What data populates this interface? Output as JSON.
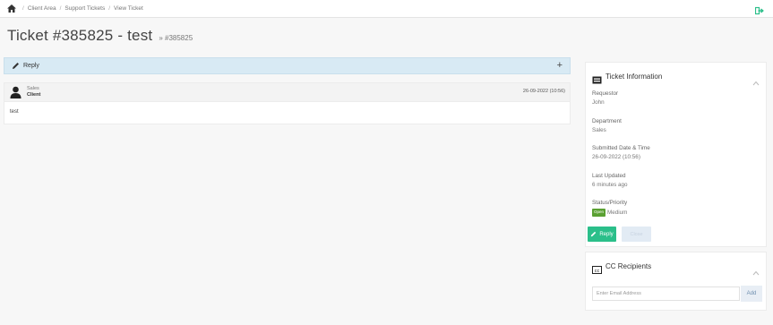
{
  "breadcrumb": {
    "items": [
      "Client Area",
      "Support Tickets",
      "View Ticket"
    ],
    "separator": "/"
  },
  "header": {
    "title": "Ticket #385825 - test",
    "subtitle": "» #385825"
  },
  "reply_bar": {
    "label": "Reply",
    "expand_symbol": "+"
  },
  "message": {
    "author": "Sales",
    "role": "Client",
    "date": "26-09-2022 (10:56)",
    "body": "test"
  },
  "ticket_info": {
    "title": "Ticket Information",
    "fields": [
      {
        "label": "Requestor",
        "value": "John"
      },
      {
        "label": "Department",
        "value": "Sales"
      },
      {
        "label": "Submitted Date & Time",
        "value": "26-09-2022 (10:56)"
      },
      {
        "label": "Last Updated",
        "value": "6 minutes ago"
      }
    ],
    "status_label": "Status/Priority",
    "status_badge": "Open",
    "priority": "Medium",
    "reply_button": "Reply",
    "close_button": "Close"
  },
  "cc": {
    "title": "CC Recipients",
    "input_placeholder": "Enter Email Address",
    "add_button": "Add"
  },
  "colors": {
    "accent_green": "#2bbf8a",
    "status_open": "#5aa032",
    "reply_bar_bg": "#d8eaf4",
    "logout_icon": "#2bbf8a"
  },
  "icons": [
    "home-icon",
    "logout-icon",
    "pencil-icon",
    "plus-icon",
    "user-icon",
    "ticket-icon",
    "chevron-up-icon",
    "cc-icon"
  ]
}
